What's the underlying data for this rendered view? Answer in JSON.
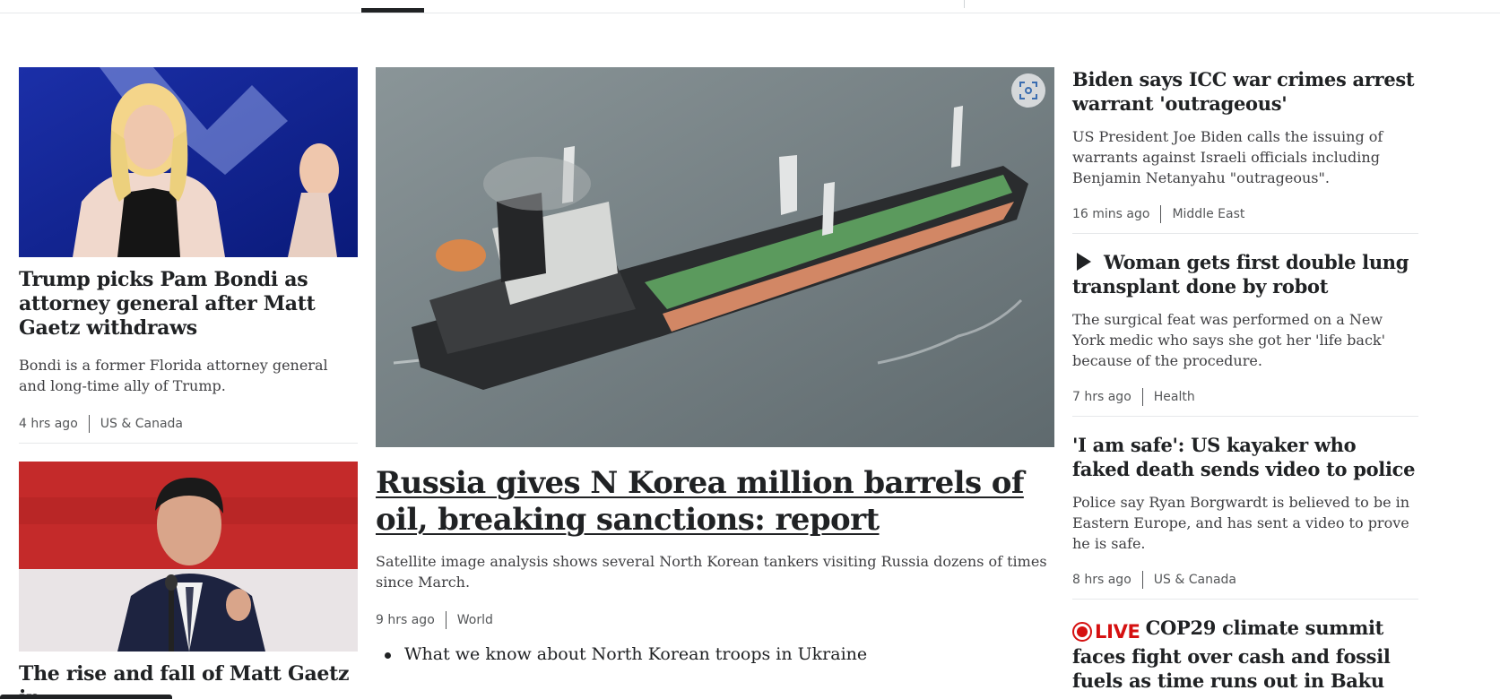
{
  "featured": {
    "title": "Russia gives N Korea million barrels of oil, breaking sanctions: report",
    "description": "Satellite image analysis shows several North Korean tankers visiting Russia dozens of times since March.",
    "time": "9 hrs ago",
    "section": "World",
    "related": [
      "What we know about North Korean troops in Ukraine"
    ]
  },
  "left_stories": [
    {
      "title": "Trump picks Pam Bondi as attorney general after Matt Gaetz withdraws",
      "description": "Bondi is a former Florida attorney general and long-time ally of Trump.",
      "time": "4 hrs ago",
      "section": "US & Canada"
    },
    {
      "title": "The rise and fall of Matt Gaetz in"
    }
  ],
  "right_stories": [
    {
      "title": "Biden says ICC war crimes arrest warrant 'outrageous'",
      "description": "US President Joe Biden calls the issuing of warrants against Israeli officials including Benjamin Netanyahu \"outrageous\".",
      "time": "16 mins ago",
      "section": "Middle East"
    },
    {
      "title": "Woman gets first double lung transplant done by robot",
      "description": "The surgical feat was performed on a New York medic who says she got her 'life back' because of the procedure.",
      "time": "7 hrs ago",
      "section": "Health",
      "icon": "play-icon"
    },
    {
      "title": "'I am safe': US kayaker who faked death sends video to police",
      "description": "Police say Ryan Borgwardt is believed to be in Eastern Europe, and has sent a video to prove he is safe.",
      "time": "8 hrs ago",
      "section": "US & Canada"
    },
    {
      "live_label": "LIVE",
      "title": "COP29 climate summit faces fight over cash and fossil fuels as time runs out in Baku"
    }
  ],
  "colors": {
    "live_red": "#d51010",
    "text": "#202224",
    "meta": "#545658"
  }
}
